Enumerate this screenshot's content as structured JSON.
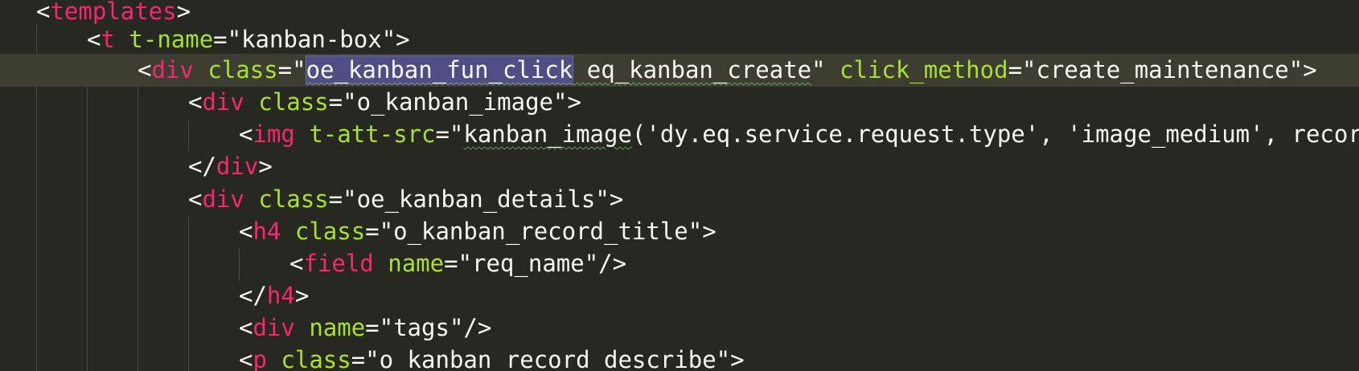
{
  "editor": {
    "lines": [
      {
        "open": "<",
        "tag": "templates",
        "close": ">"
      },
      {
        "open": "<",
        "tag": "t",
        "attr1": "t-name",
        "eq1": "=\"",
        "val1": "kanban-box",
        "q1": "\"",
        "close": ">"
      },
      {
        "open": "<",
        "tag": "div",
        "attr1": "class",
        "eq1": "=\"",
        "val1a": "oe_kanban_fun_click",
        "val1b": " eq_kanban_create",
        "q1": "\"",
        "attr2": "click_method",
        "eq2": "=\"",
        "val2": "create_maintenance",
        "q2": "\"",
        "close": ">"
      },
      {
        "open": "<",
        "tag": "div",
        "attr1": "class",
        "eq1": "=\"",
        "val1": "o_kanban_image",
        "q1": "\"",
        "close": ">"
      },
      {
        "open": "<",
        "tag": "img",
        "attr1": "t-att-src",
        "eq1": "=\"",
        "val1a": "kanban_image",
        "val1b": "('dy.eq.service.request.type', 'image_medium', record"
      },
      {
        "open": "</",
        "tag": "div",
        "close": ">"
      },
      {
        "open": "<",
        "tag": "div",
        "attr1": "class",
        "eq1": "=\"",
        "val1": "oe_kanban_details",
        "q1": "\"",
        "close": ">"
      },
      {
        "open": "<",
        "tag": "h4",
        "attr1": "class",
        "eq1": "=\"",
        "val1": "o_kanban_record_title",
        "q1": "\"",
        "close": ">"
      },
      {
        "open": "<",
        "tag": "field",
        "attr1": "name",
        "eq1": "=\"",
        "val1": "req_name",
        "q1": "\"",
        "close": "/>"
      },
      {
        "open": "</",
        "tag": "h4",
        "close": ">"
      },
      {
        "open": "<",
        "tag": "div",
        "attr1": "name",
        "eq1": "=\"",
        "val1": "tags",
        "q1": "\"",
        "close": "/>"
      },
      {
        "open": "<",
        "tag": "p",
        "attr1": "class",
        "eq1": "=\"",
        "val1": "o_kanban_record_describe",
        "q1": "\"",
        "close": ">"
      }
    ]
  },
  "colors": {
    "background": "#272822",
    "current_line": "#3e3d32",
    "tag": "#f92672",
    "attribute": "#a6e22e",
    "string": "#e6db74",
    "punctuation": "#f8f8f2",
    "selection": "#514e86"
  }
}
